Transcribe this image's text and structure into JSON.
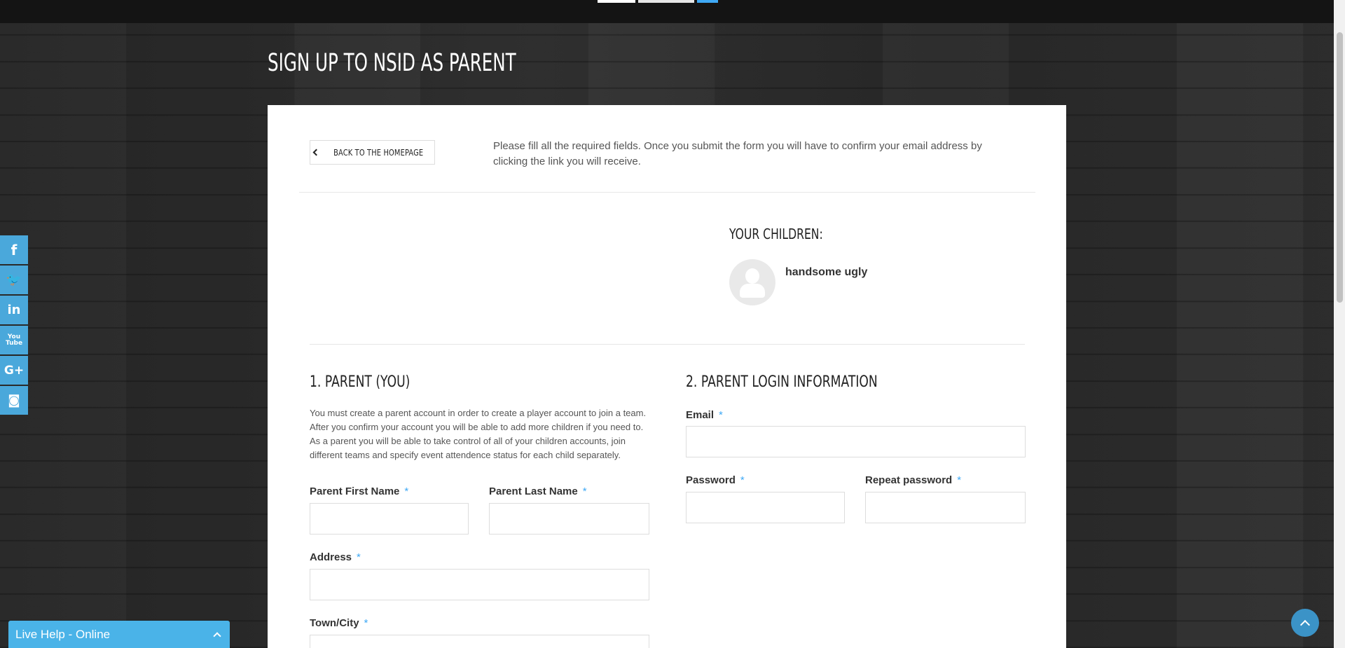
{
  "header": {
    "logo_alt": "NSID"
  },
  "page_title": "SIGN UP TO NSID AS PARENT",
  "back_button": "BACK TO THE HOMEPAGE",
  "intro_text": "Please fill all the required fields. Once you submit the form you will have to confirm your email address by clicking the link you will receive.",
  "children": {
    "title": "YOUR CHILDREN:",
    "items": [
      {
        "name": "handsome ugly"
      }
    ]
  },
  "parent_section": {
    "title": "1. PARENT (YOU)",
    "description": "You must create a parent account in order to create a player account to join a team. After you confirm your account you will be able to add more children if you need to. As a parent you will be able to take control of all of your children accounts, join different teams and specify event attendence status for each child separately.",
    "fields": {
      "first_name": {
        "label": "Parent First Name",
        "required": "*",
        "value": ""
      },
      "last_name": {
        "label": "Parent Last Name",
        "required": "*",
        "value": ""
      },
      "address": {
        "label": "Address",
        "required": "*",
        "value": ""
      },
      "town": {
        "label": "Town/City",
        "required": "*",
        "value": ""
      }
    }
  },
  "login_section": {
    "title": "2. PARENT LOGIN INFORMATION",
    "fields": {
      "email": {
        "label": "Email",
        "required": "*",
        "value": ""
      },
      "password": {
        "label": "Password",
        "required": "*",
        "value": ""
      },
      "repeat_password": {
        "label": "Repeat password",
        "required": "*",
        "value": ""
      }
    }
  },
  "social": [
    {
      "icon": "facebook-icon",
      "glyph": "f"
    },
    {
      "icon": "twitter-icon",
      "glyph": "🐦"
    },
    {
      "icon": "linkedin-icon",
      "glyph": "in"
    },
    {
      "icon": "youtube-icon",
      "glyph": "You\nTube"
    },
    {
      "icon": "google-plus-icon",
      "glyph": "G+"
    },
    {
      "icon": "instagram-icon",
      "glyph": "◙"
    }
  ],
  "live_help": "Live Help - Online",
  "colors": {
    "accent": "#3fa9f5",
    "social_bg": "#4aa8db",
    "live_help_bg": "#4ab3e8"
  }
}
